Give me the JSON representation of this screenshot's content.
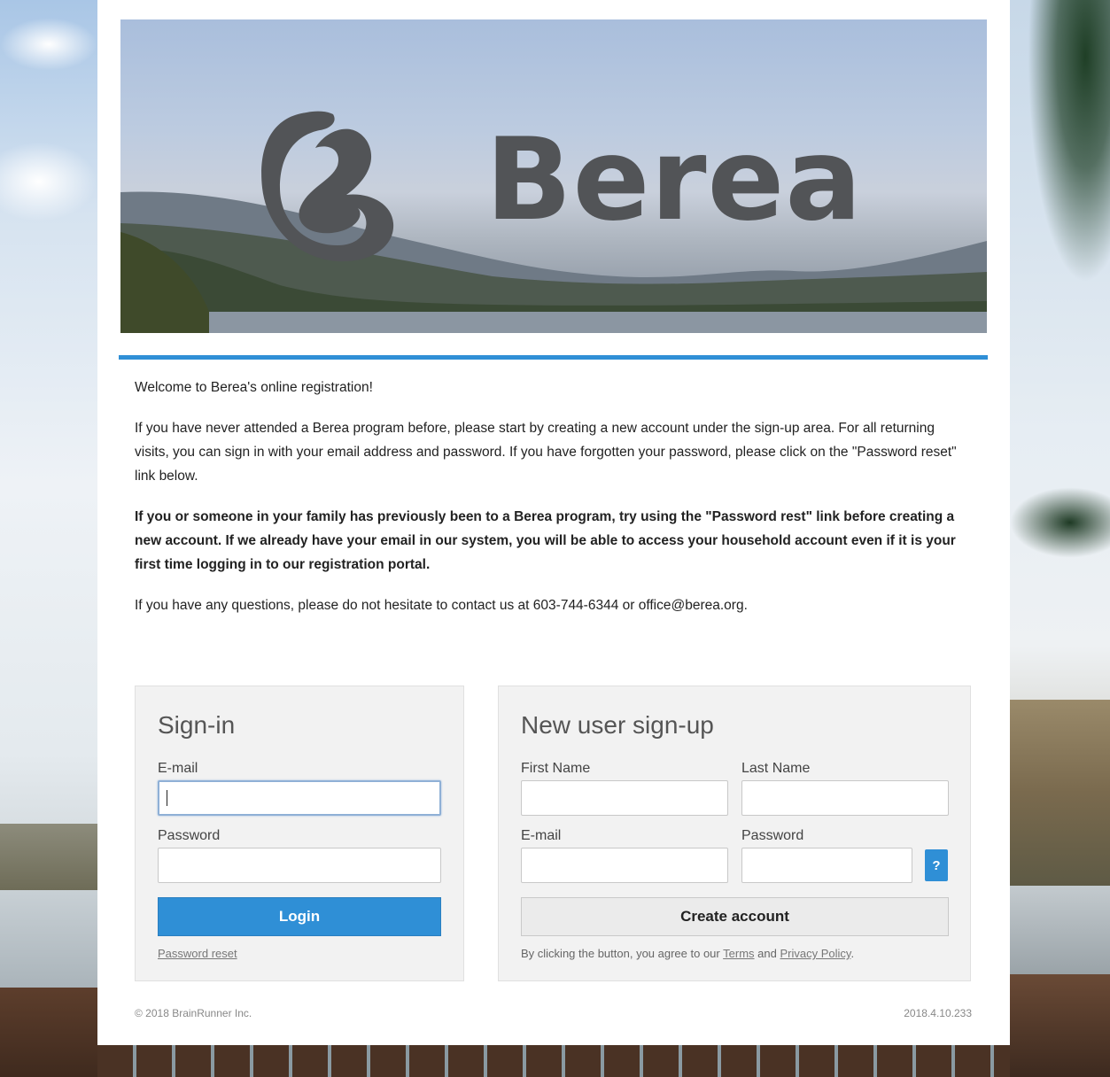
{
  "banner": {
    "wordmark": "Berea"
  },
  "intro": {
    "welcome": "Welcome to Berea's online registration!",
    "paragraph1": "If you have never attended a Berea program before, please start by creating a new account under the sign-up area. For all returning visits, you can sign in with your email address and password. If you have forgotten your password, please click on the \"Password reset\" link below.",
    "paragraph2": "If you or someone in your family has previously been to a Berea program, try using the \"Password rest\" link before creating a new account. If we already have your email in our system, you will be able to access your household account even if it is your first time logging in to our registration portal.",
    "paragraph3": "If you have any questions, please do not hesitate to contact us at 603-744-6344 or office@berea.org."
  },
  "signin": {
    "title": "Sign-in",
    "email_label": "E-mail",
    "email_value": "",
    "password_label": "Password",
    "password_value": "",
    "login_button": "Login",
    "password_reset_link": "Password reset"
  },
  "signup": {
    "title": "New user sign-up",
    "first_name_label": "First Name",
    "last_name_label": "Last Name",
    "email_label": "E-mail",
    "password_label": "Password",
    "help_button": "?",
    "create_button": "Create account",
    "terms_prefix": "By clicking the button, you agree to our",
    "terms_link": "Terms",
    "terms_and": "and",
    "privacy_link": "Privacy Policy",
    "terms_suffix": "."
  },
  "footer": {
    "copyright": "© 2018 BrainRunner Inc.",
    "version": "2018.4.10.233"
  },
  "colors": {
    "accent": "#2f8fd6",
    "panel": "#f2f2f2",
    "logo": "#525457"
  },
  "icons": {
    "help": "question-mark"
  }
}
